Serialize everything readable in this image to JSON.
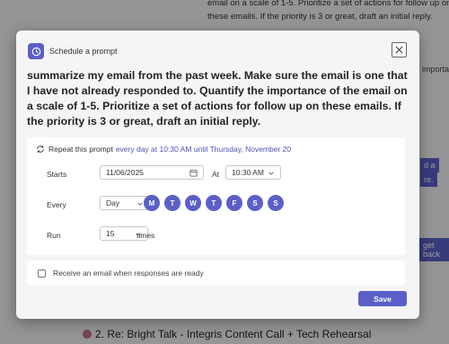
{
  "background": {
    "line1": "email on a scale of 1-5. Prioritize a set of actions for follow up on",
    "line2": "these emails. If the priority is 3 or great, draft an initial reply.",
    "frag_importa": "importa",
    "frag_d_a": "d a",
    "frag_re": "re.",
    "frag_get_back": "get back",
    "list_item": "2. Re: Bright Talk - Integris Content Call + Tech Rehearsal"
  },
  "dialog": {
    "title": "Schedule a prompt",
    "prompt": "summarize my email from the past week. Make sure the email is one that I have not already responded to. Quantify the importance of the email on a scale of 1-5. Prioritize a set of actions for follow up on these emails. If the priority is 3 or great, draft an initial reply.",
    "repeat_prefix": "Repeat this prompt",
    "repeat_link": "every day at 10:30 AM until Thursday, November 20",
    "starts_label": "Starts",
    "start_date": "11/06/2025",
    "at_label": "At",
    "start_time": "10:30 AM",
    "every_label": "Every",
    "frequency": "Day",
    "days": [
      "M",
      "T",
      "W",
      "T",
      "F",
      "S",
      "S"
    ],
    "run_label": "Run",
    "run_count": "15",
    "times_label": "times",
    "email_checkbox_label": "Receive an email when responses are ready",
    "email_checked": false,
    "save_label": "Save"
  },
  "colors": {
    "accent": "#5b5fc7",
    "link": "#4f52b2"
  }
}
